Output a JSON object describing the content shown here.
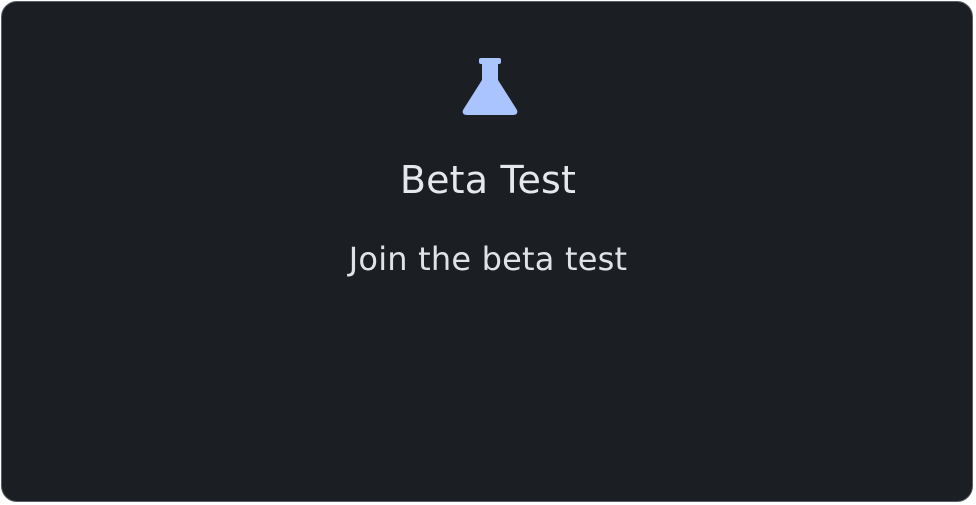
{
  "card": {
    "icon": "flask-icon",
    "icon_color": "#aac4ff",
    "title": "Beta Test",
    "subtitle": "Join the beta test"
  }
}
